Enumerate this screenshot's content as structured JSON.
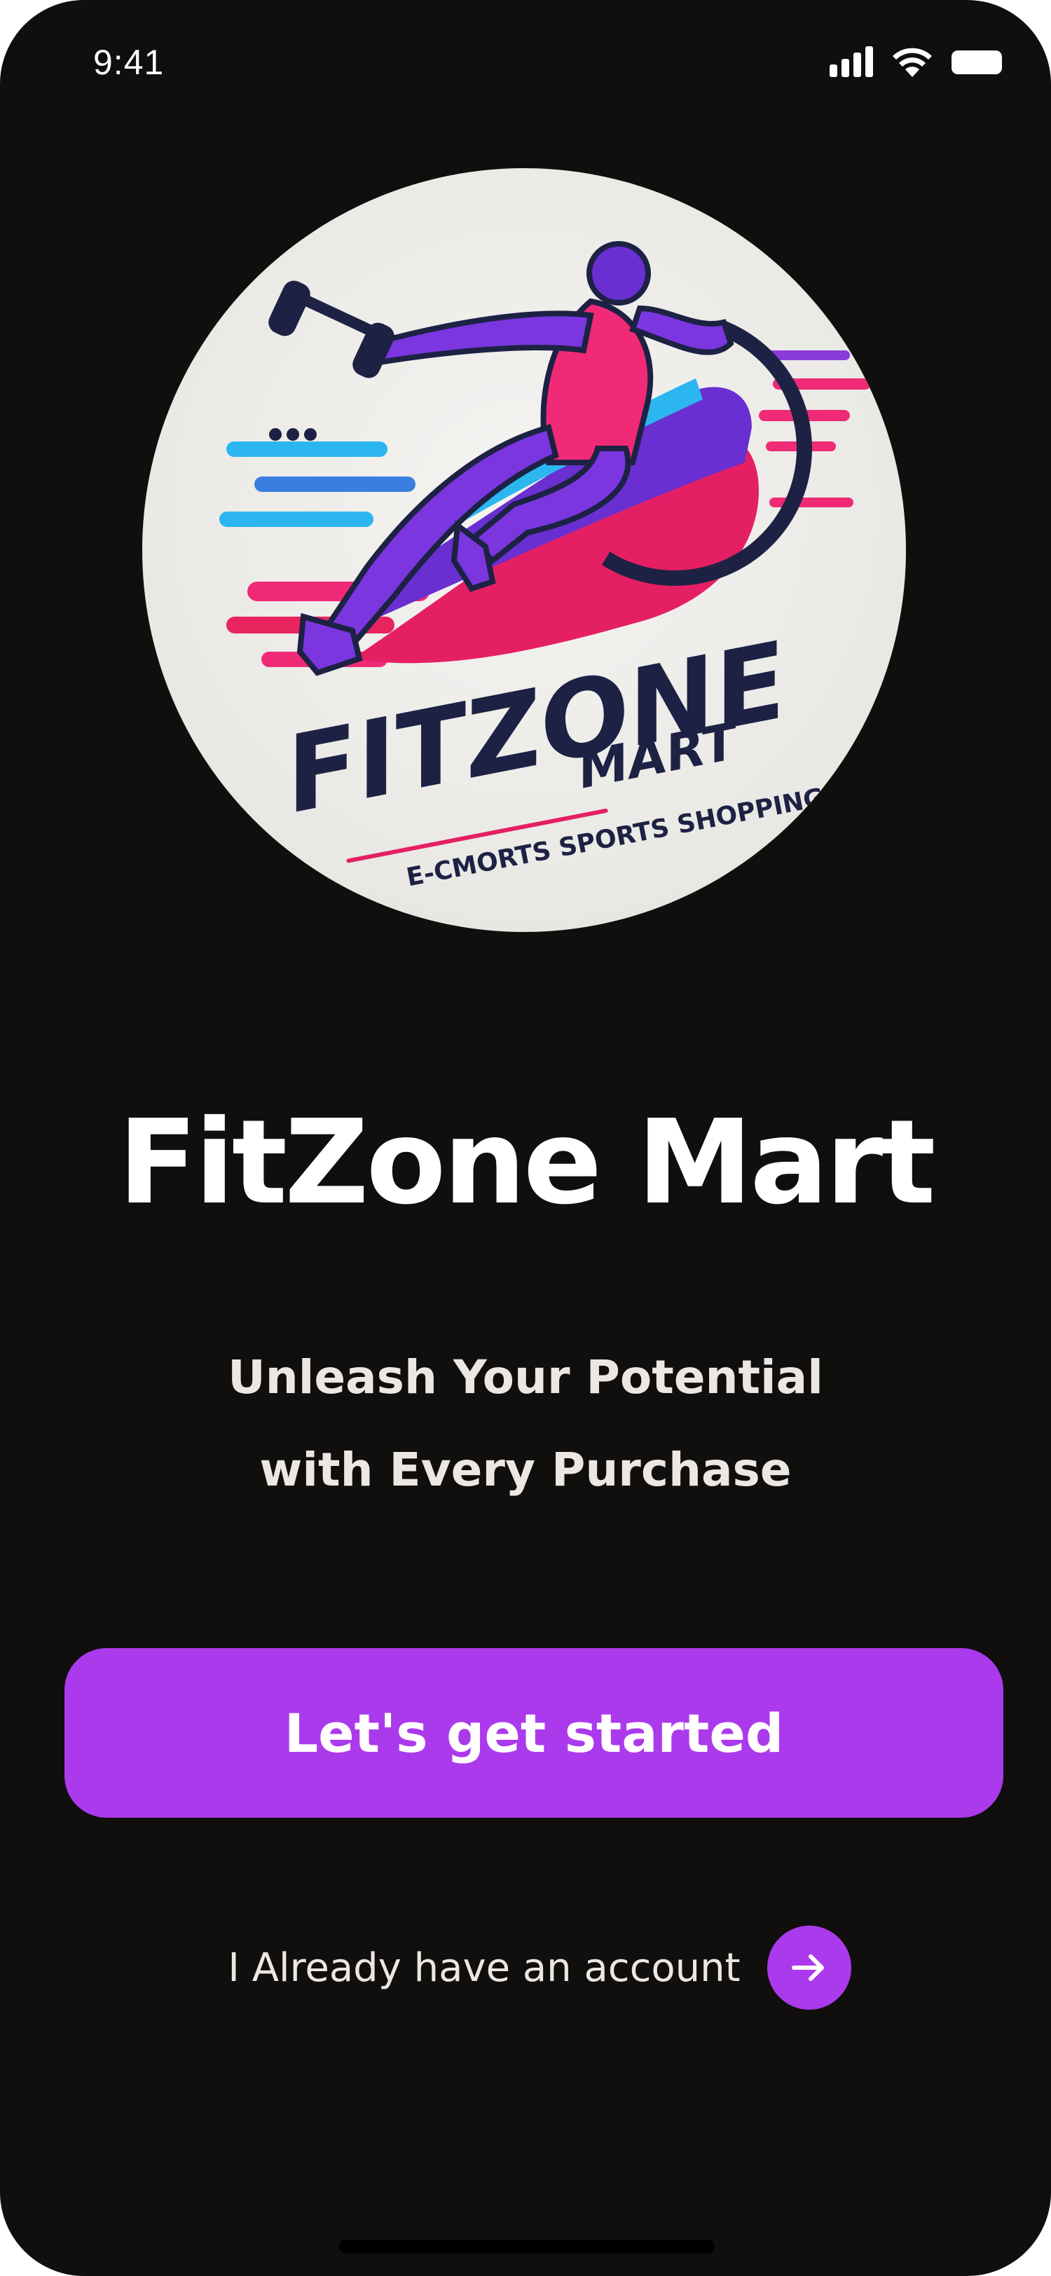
{
  "status_bar": {
    "time": "9:41",
    "icons": [
      "signal-icon",
      "wifi-icon",
      "battery-icon"
    ]
  },
  "logo": {
    "icon": "runner-with-dumbbell-logo",
    "wordmark": "FITZONE",
    "subword": "MART",
    "slogan": "E-CMORTS SPORTS SHOPPING"
  },
  "welcome": {
    "title": "FitZone Mart",
    "tagline_line1": "Unleash Your Potential",
    "tagline_line2": "with Every Purchase"
  },
  "actions": {
    "primary_label": "Let's get started",
    "secondary_label": "I Already have an account",
    "secondary_icon": "arrow-right-icon"
  },
  "colors": {
    "background": "#110e0e",
    "accent": "#ab3aec",
    "text": "#ffffff",
    "text_muted": "#ebe7e3"
  }
}
